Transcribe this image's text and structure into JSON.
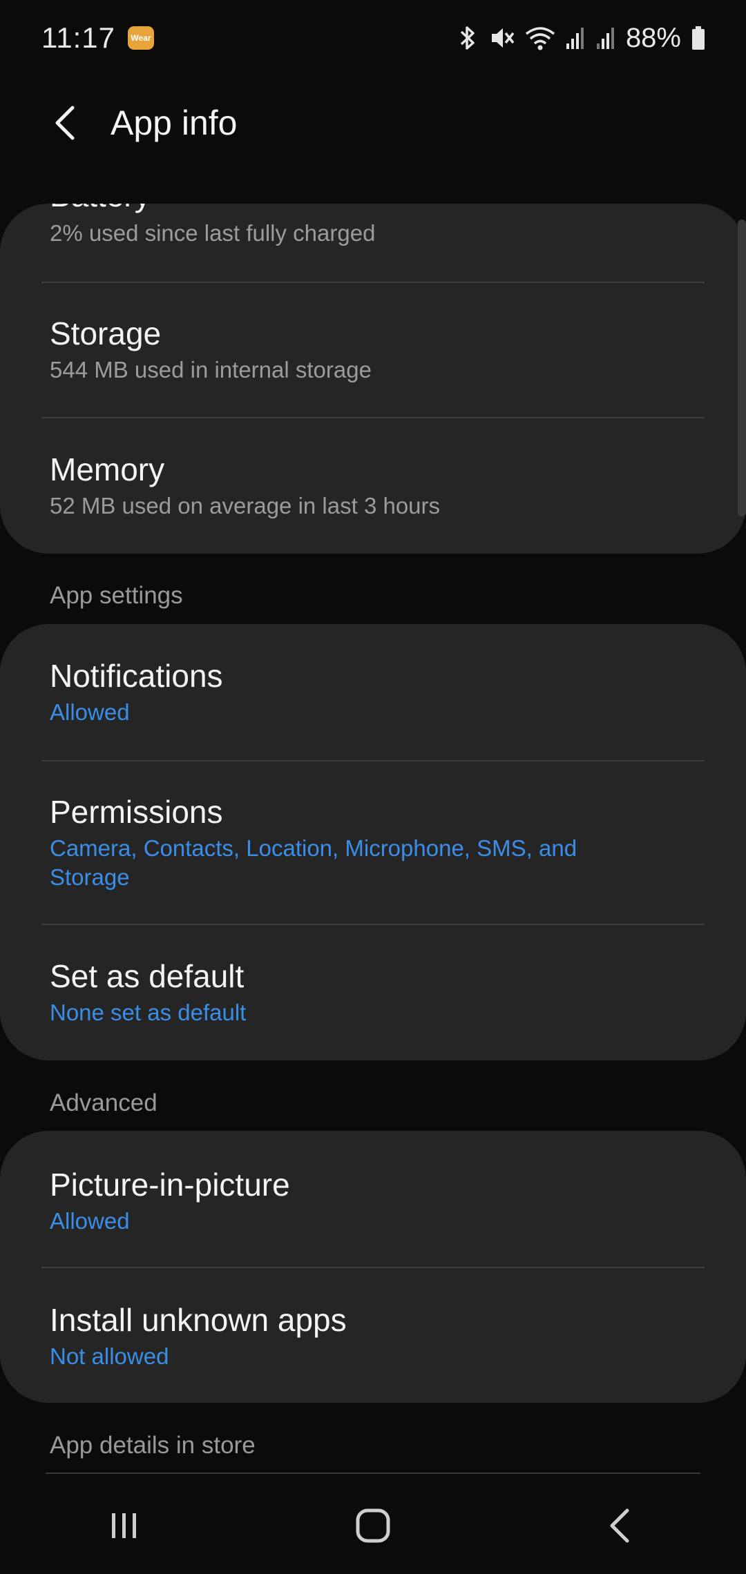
{
  "status": {
    "time": "11:17",
    "wear_badge": "Wear",
    "battery_percent": "88%",
    "icons": [
      "bluetooth-icon",
      "mute-icon",
      "wifi-icon",
      "signal-icon",
      "signal-icon",
      "battery-icon"
    ]
  },
  "app_bar": {
    "title": "App info",
    "back_icon": "back-arrow-icon"
  },
  "group1": {
    "items": [
      {
        "title": "Battery",
        "subtitle": "2% used since last fully charged"
      },
      {
        "title": "Storage",
        "subtitle": "544 MB used in internal storage"
      },
      {
        "title": "Memory",
        "subtitle": "52 MB used on average in last 3 hours"
      }
    ]
  },
  "app_settings": {
    "label": "App settings",
    "items": [
      {
        "title": "Notifications",
        "subtitle": "Allowed"
      },
      {
        "title": "Permissions",
        "subtitle_line1": "Camera, Contacts, Location, Microphone, SMS, and",
        "subtitle_line2": "Storage"
      },
      {
        "title": "Set as default",
        "subtitle": "None set as default"
      }
    ]
  },
  "advanced": {
    "label": "Advanced",
    "items": [
      {
        "title": "Picture-in-picture",
        "subtitle": "Allowed"
      },
      {
        "title": "Install unknown apps",
        "subtitle": "Not allowed"
      }
    ]
  },
  "store": {
    "label": "App details in store"
  },
  "nav": {
    "icons": [
      "recents-icon",
      "home-icon",
      "back-icon"
    ]
  },
  "colors": {
    "background": "#0b0b0b",
    "card": "#252525",
    "accent_blue": "#3b8ee8",
    "secondary_text": "#9c9c9c"
  }
}
